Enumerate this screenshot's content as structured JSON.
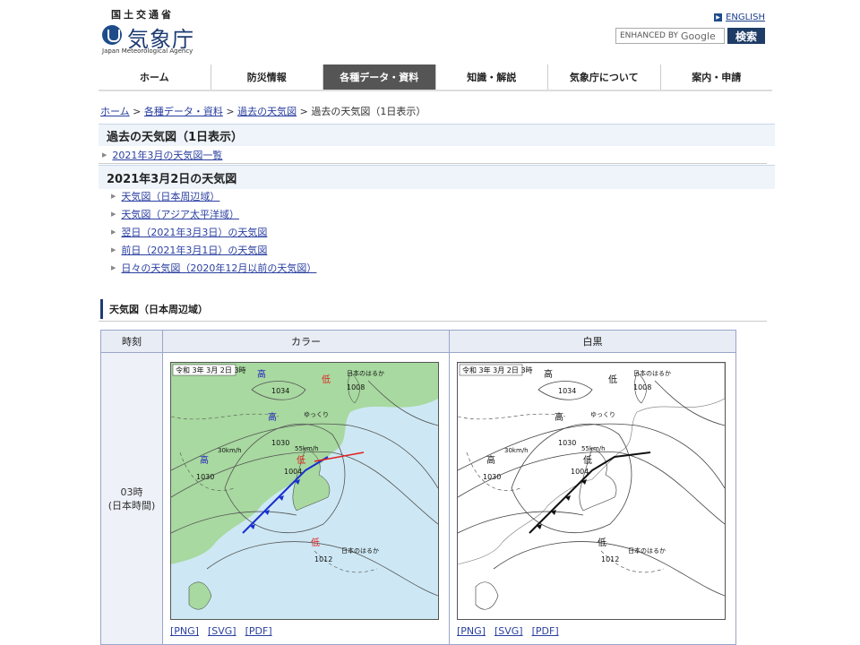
{
  "header": {
    "ministry": "国土交通省",
    "agency_name": "気象庁",
    "agency_en": "Japan Meteorological Agency",
    "english_link": "ENGLISH",
    "search_placeholder_prefix": "ENHANCED BY",
    "search_placeholder_brand": "Google",
    "search_button": "検索"
  },
  "nav": [
    {
      "label": "ホーム"
    },
    {
      "label": "防災情報"
    },
    {
      "label": "各種データ・資料",
      "active": true
    },
    {
      "label": "知識・解説"
    },
    {
      "label": "気象庁について"
    },
    {
      "label": "案内・申請"
    }
  ],
  "breadcrumb": {
    "items": [
      "ホーム",
      "各種データ・資料",
      "過去の天気図"
    ],
    "separator": ">",
    "current": "過去の天気図（1日表示）"
  },
  "page_title": "過去の天気図（1日表示）",
  "month_list_link": "2021年3月の天気図一覧",
  "date_title": "2021年3月2日の天気図",
  "links": [
    "天気図（日本周辺域）",
    "天気図（アジア太平洋域）",
    "翌日（2021年3月3日）の天気図",
    "前日（2021年3月1日）の天気図",
    "日々の天気図（2020年12月以前の天気図）"
  ],
  "section_title": "天気図（日本周辺域）",
  "table": {
    "headers": {
      "time": "時刻",
      "color": "カラー",
      "mono": "白黒"
    },
    "row": {
      "time": "03時",
      "time_note": "(日本時間)"
    },
    "formats": [
      "[PNG]",
      "[SVG]",
      "[PDF]"
    ]
  },
  "map": {
    "stamp": "令和 3年 3月 2日 3時",
    "high_label": "高",
    "low_label": "低",
    "pressures": [
      "1034",
      "1030",
      "1030",
      "1008",
      "1004",
      "1012"
    ],
    "speeds": [
      "55km/h",
      "30km/h"
    ],
    "warning": "ゆっくり",
    "note": "日本のはるか"
  },
  "colors": {
    "nav_active": "#555555",
    "link": "#2a3fa0",
    "brand": "#1e3c72",
    "sea": "#cde8f4",
    "land": "#a8d9a0",
    "front_cold": "#1a2fd0",
    "front_warm": "#e02020",
    "low_red": "#e02020",
    "high_blue": "#2020c0"
  }
}
